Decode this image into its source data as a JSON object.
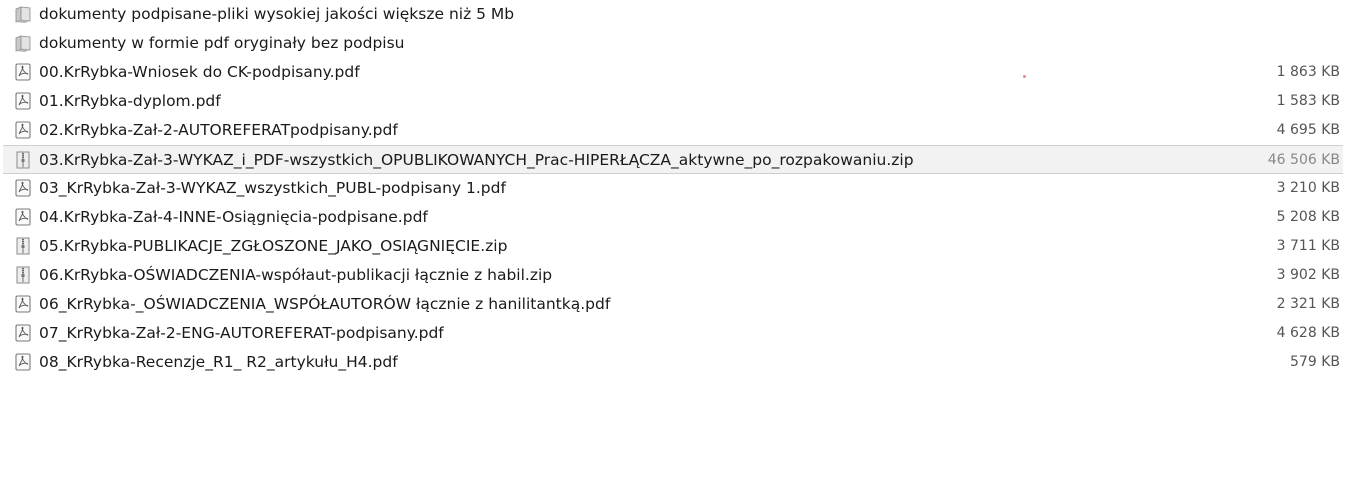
{
  "files": [
    {
      "name": "dokumenty podpisane-pliki wysokiej jakości większe niż 5 Mb",
      "size": "",
      "icon": "folder-icon",
      "selected": false
    },
    {
      "name": "dokumenty w formie pdf oryginały bez podpisu",
      "size": "",
      "icon": "folder-icon",
      "selected": false
    },
    {
      "name": "00.KrRybka-Wniosek do CK-podpisany.pdf",
      "size": "1 863 KB",
      "icon": "pdf-file-icon",
      "selected": false
    },
    {
      "name": "01.KrRybka-dyplom.pdf",
      "size": "1 583 KB",
      "icon": "pdf-file-icon",
      "selected": false
    },
    {
      "name": "02.KrRybka-Zał-2-AUTOREFERATpodpisany.pdf",
      "size": "4 695 KB",
      "icon": "pdf-file-icon",
      "selected": false
    },
    {
      "name": "03.KrRybka-Zał-3-WYKAZ_i_PDF-wszystkich_OPUBLIKOWANYCH_Prac-HIPERŁĄCZA_aktywne_po_rozpakowaniu.zip",
      "size": "46 506 KB",
      "icon": "zip-file-icon",
      "selected": true
    },
    {
      "name": "03_KrRybka-Zał-3-WYKAZ_wszystkich_PUBL-podpisany 1.pdf",
      "size": "3 210 KB",
      "icon": "pdf-file-icon",
      "selected": false
    },
    {
      "name": "04.KrRybka-Zał-4-INNE-Osiągnięcia-podpisane.pdf",
      "size": "5 208 KB",
      "icon": "pdf-file-icon",
      "selected": false
    },
    {
      "name": "05.KrRybka-PUBLIKACJE_ZGŁOSZONE_JAKO_OSIĄGNIĘCIE.zip",
      "size": "3 711 KB",
      "icon": "zip-file-icon",
      "selected": false
    },
    {
      "name": "06.KrRybka-OŚWIADCZENIA-współaut-publikacji łącznie z habil.zip",
      "size": "3 902 KB",
      "icon": "zip-file-icon",
      "selected": false
    },
    {
      "name": "06_KrRybka-_OŚWIADCZENIA_WSPÓŁAUTORÓW łącznie z hanilitantką.pdf",
      "size": "2 321 KB",
      "icon": "pdf-file-icon",
      "selected": false
    },
    {
      "name": "07_KrRybka-Zał-2-ENG-AUTOREFERAT-podpisany.pdf",
      "size": "4 628 KB",
      "icon": "pdf-file-icon",
      "selected": false
    },
    {
      "name": "08_KrRybka-Recenzje_R1_ R2_artykułu_H4.pdf",
      "size": "579 KB",
      "icon": "pdf-file-icon",
      "selected": false
    }
  ]
}
